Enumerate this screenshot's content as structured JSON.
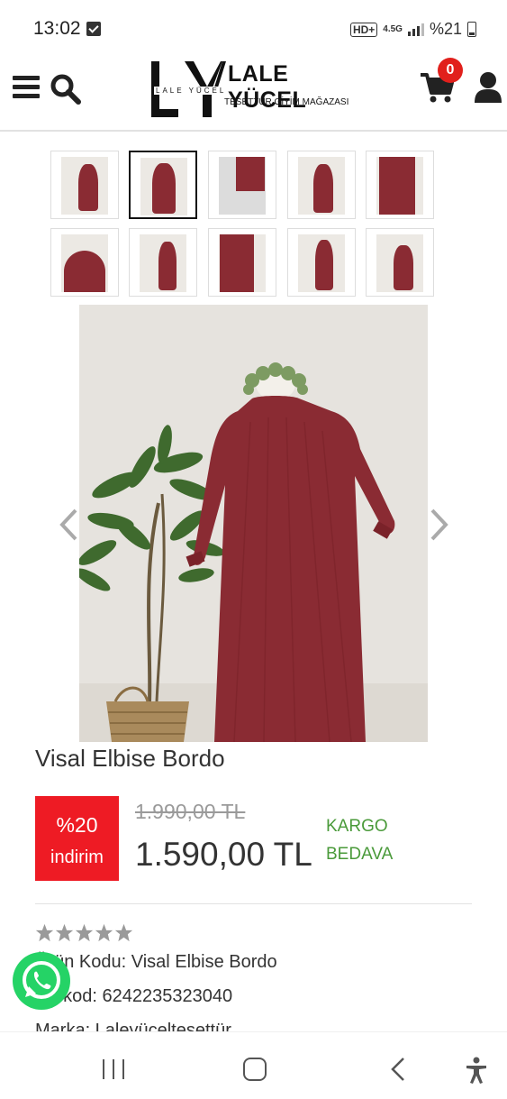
{
  "status_bar": {
    "time": "13:02",
    "hd": "HD+",
    "network": "4.5G",
    "battery": "%21"
  },
  "header": {
    "logo": {
      "brand": "LALE YÜCEL",
      "tagline": "TESETTÜR GİYİM MAĞAZASI",
      "mark_text": "LALE YÜCEL"
    },
    "cart_count": "0",
    "icons": [
      "menu-icon",
      "search-icon",
      "cart-icon",
      "user-icon"
    ]
  },
  "gallery": {
    "thumbnail_count": 10,
    "active_thumbnail": 2,
    "product_color": "#8a2b33"
  },
  "product": {
    "title": "Visal Elbise Bordo",
    "discount_percent": "%20",
    "discount_label": "indirim",
    "old_price": "1.990,00 TL",
    "new_price": "1.590,00 TL",
    "shipping_line1": "KARGO",
    "shipping_line2": "BEDAVA",
    "rating_stars": 5,
    "info_lines": [
      "Ürün Kodu: Visal Elbise Bordo",
      "Barkod: 6242235323040",
      "Marka: Laleyüceltesettür"
    ]
  },
  "colors": {
    "accent_red": "#ee1b24",
    "shipping_green": "#4a9a3a",
    "badge_red": "#e1201c",
    "whatsapp_green": "#25d366"
  }
}
